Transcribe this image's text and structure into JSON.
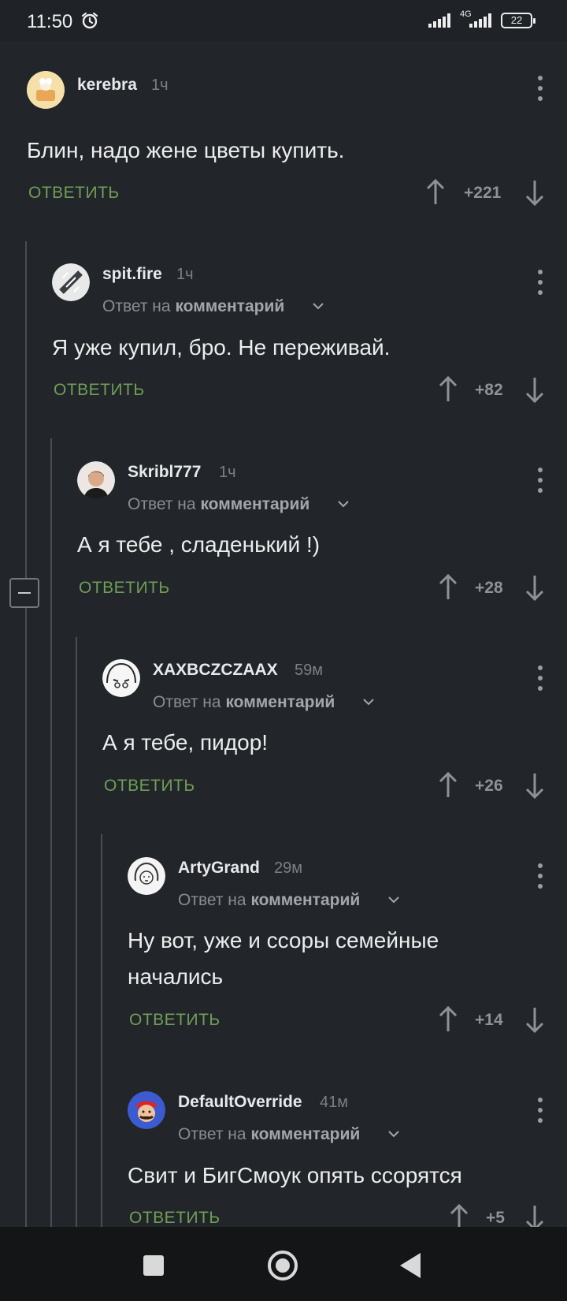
{
  "status_bar": {
    "time": "11:50",
    "network": "4G",
    "battery": "22"
  },
  "reply_label": "ОТВЕТИТЬ",
  "reply_to_prefix": "Ответ на",
  "reply_to_target": "комментарий",
  "comments": [
    {
      "author": "kerebra",
      "time": "1ч",
      "text": "Блин, надо жене цветы купить.",
      "score": "+221"
    },
    {
      "author": "spit.fire",
      "time": "1ч",
      "text": "Я уже купил, бро. Не переживай.",
      "score": "+82"
    },
    {
      "author": "Skribl777",
      "time": "1ч",
      "text": "А я тебе , сладенький !)",
      "score": "+28"
    },
    {
      "author": "XAXBCZCZAAX",
      "time": "59м",
      "text": "А я тебе, пидор!",
      "score": "+26"
    },
    {
      "author": "ArtyGrand",
      "time": "29м",
      "text": "Ну вот, уже и ссоры семейные начались",
      "score": "+14"
    },
    {
      "author": "DefaultOverride",
      "time": "41м",
      "text": "Свит и БигСмоук опять ссорятся",
      "score": "+5"
    }
  ],
  "colors": {
    "background": "#22252a",
    "reply_green": "#6f9e55",
    "text": "#eceded",
    "muted": "#898d93"
  }
}
